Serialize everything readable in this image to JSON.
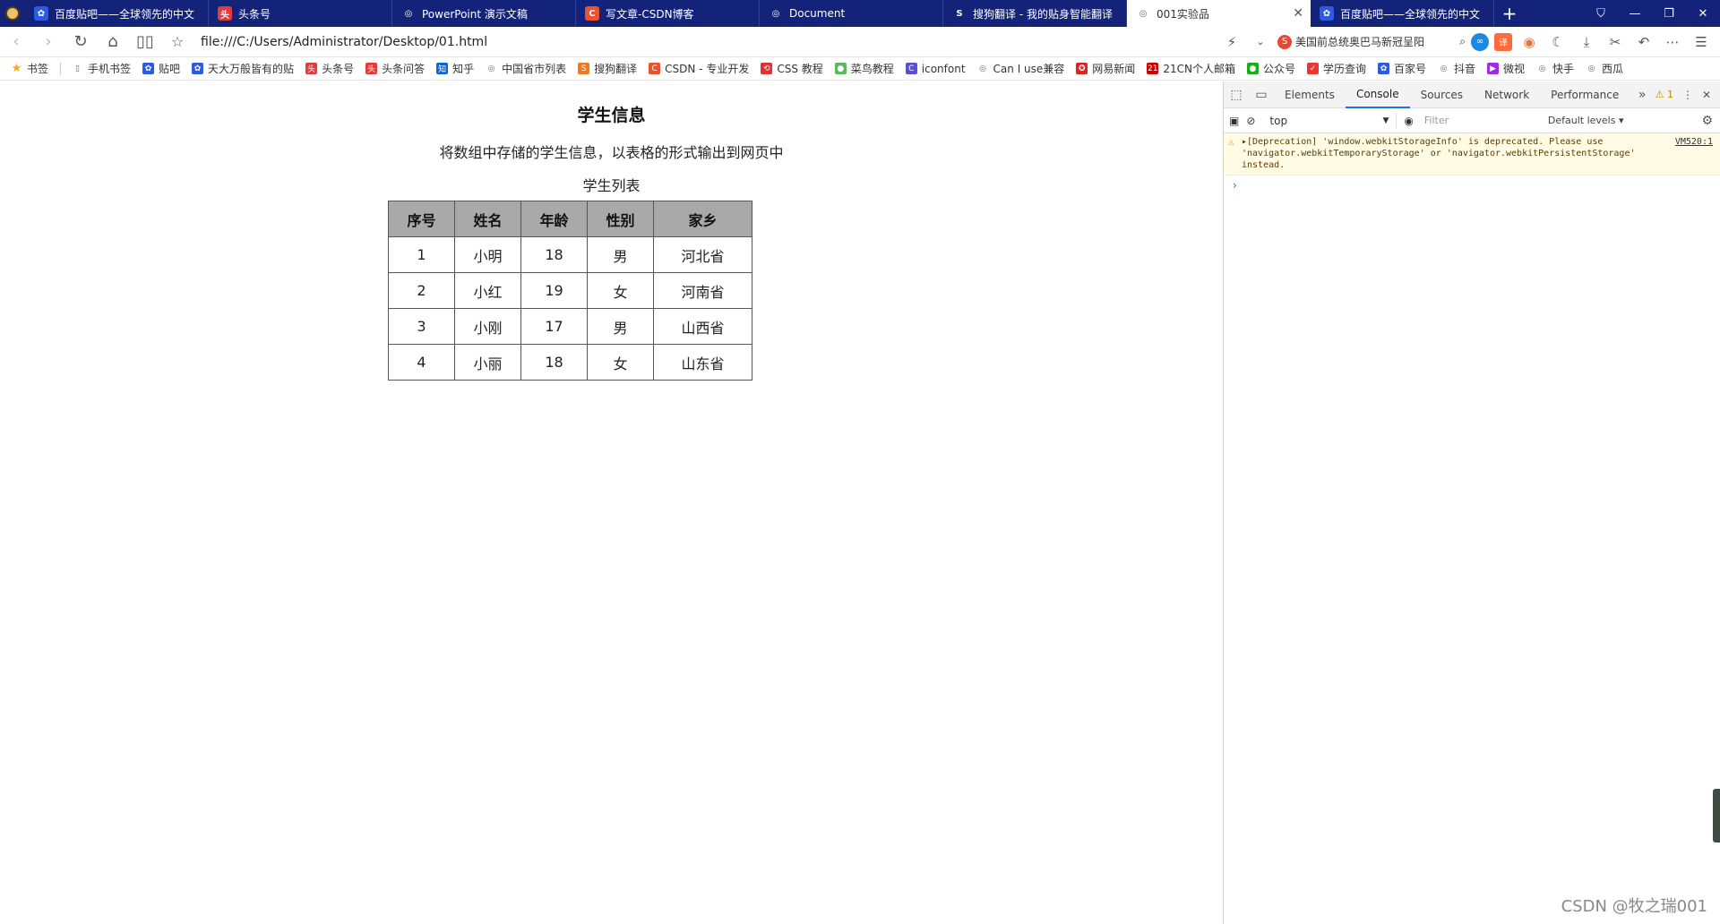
{
  "browser": {
    "tabs": [
      {
        "title": "百度贴吧——全球领先的中文",
        "icon_color": "#2d5be3",
        "icon": "baidu-icon",
        "glyph": "✿"
      },
      {
        "title": "头条号",
        "icon_color": "#e33a3a",
        "icon": "toutiao-icon",
        "glyph": "头"
      },
      {
        "title": "PowerPoint 演示文稿",
        "icon_color": "transparent",
        "icon": "globe-icon",
        "glyph": "◎"
      },
      {
        "title": "写文章-CSDN博客",
        "icon_color": "#e8542e",
        "icon": "csdn-icon",
        "glyph": "C"
      },
      {
        "title": "Document",
        "icon_color": "transparent",
        "icon": "globe-icon",
        "glyph": "◎"
      },
      {
        "title": "搜狗翻译 - 我的贴身智能翻译",
        "icon_color": "transparent",
        "icon": "sogou-icon",
        "glyph": "S"
      },
      {
        "title": "001实验品",
        "icon_color": "transparent",
        "icon": "globe-icon",
        "glyph": "◎",
        "active": true
      },
      {
        "title": "百度贴吧——全球领先的中文",
        "icon_color": "#2d5be3",
        "icon": "baidu-icon",
        "glyph": "✿"
      }
    ],
    "url": "file:///C:/Users/Administrator/Desktop/01.html",
    "search_text": "美国前总统奥巴马新冠呈阳",
    "translate_label": "译",
    "bookmarks": [
      "书签",
      "手机书签",
      "贴吧",
      "天大万般皆有的贴",
      "头条号",
      "头条问答",
      "知乎",
      "中国省市列表",
      "搜狗翻译",
      "CSDN - 专业开发",
      "CSS 教程",
      "菜鸟教程",
      "iconfont",
      "Can I use兼容",
      "网易新闻",
      "21CN个人邮箱",
      "公众号",
      "学历查询",
      "百家号",
      "抖音",
      "微视",
      "快手",
      "西瓜"
    ]
  },
  "page": {
    "title": "学生信息",
    "subtitle": "将数组中存储的学生信息，以表格的形式输出到网页中",
    "caption": "学生列表",
    "table": {
      "headers": [
        "序号",
        "姓名",
        "年龄",
        "性别",
        "家乡"
      ],
      "rows": [
        [
          "1",
          "小明",
          "18",
          "男",
          "河北省"
        ],
        [
          "2",
          "小红",
          "19",
          "女",
          "河南省"
        ],
        [
          "3",
          "小刚",
          "17",
          "男",
          "山西省"
        ],
        [
          "4",
          "小丽",
          "18",
          "女",
          "山东省"
        ]
      ]
    }
  },
  "devtools": {
    "tabs": [
      "Elements",
      "Console",
      "Sources",
      "Network",
      "Performance"
    ],
    "active_tab": "Console",
    "warning_count": "1",
    "context": "top",
    "filter_placeholder": "Filter",
    "levels": "Default levels ▾",
    "message": "▸[Deprecation] 'window.webkitStorageInfo' is deprecated. Please use 'navigator.webkitTemporaryStorage' or 'navigator.webkitPersistentStorage' instead.",
    "message_source": "VM520:1",
    "prompt": "›"
  },
  "watermark": "CSDN @牧之瑞001"
}
